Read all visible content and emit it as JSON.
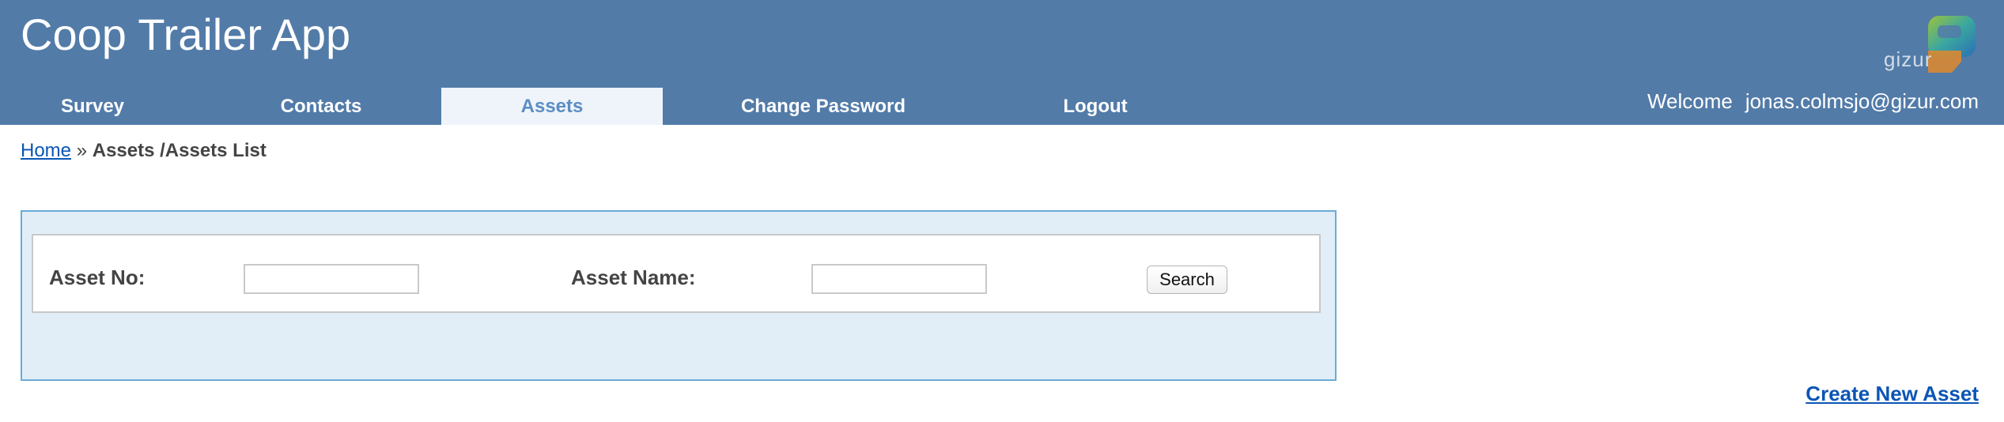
{
  "header": {
    "app_title": "Coop Trailer App",
    "logo_text": "gizur",
    "background_color": "#527ba8"
  },
  "nav": {
    "items": [
      {
        "label": "Survey",
        "active": false
      },
      {
        "label": "Contacts",
        "active": false
      },
      {
        "label": "Assets",
        "active": true
      },
      {
        "label": "Change Password",
        "active": false
      },
      {
        "label": "Logout",
        "active": false
      }
    ]
  },
  "user": {
    "welcome_label": "Welcome",
    "email": "jonas.colmsjo@gizur.com"
  },
  "breadcrumb": {
    "home_label": "Home",
    "separator": "»",
    "current": "Assets /Assets List"
  },
  "search": {
    "asset_no_label": "Asset No:",
    "asset_no_value": "",
    "asset_name_label": "Asset Name:",
    "asset_name_value": "",
    "search_button_label": "Search"
  },
  "actions": {
    "create_new_asset_label": "Create New Asset"
  },
  "icons": {
    "logo": "gizur-logo-icon"
  }
}
